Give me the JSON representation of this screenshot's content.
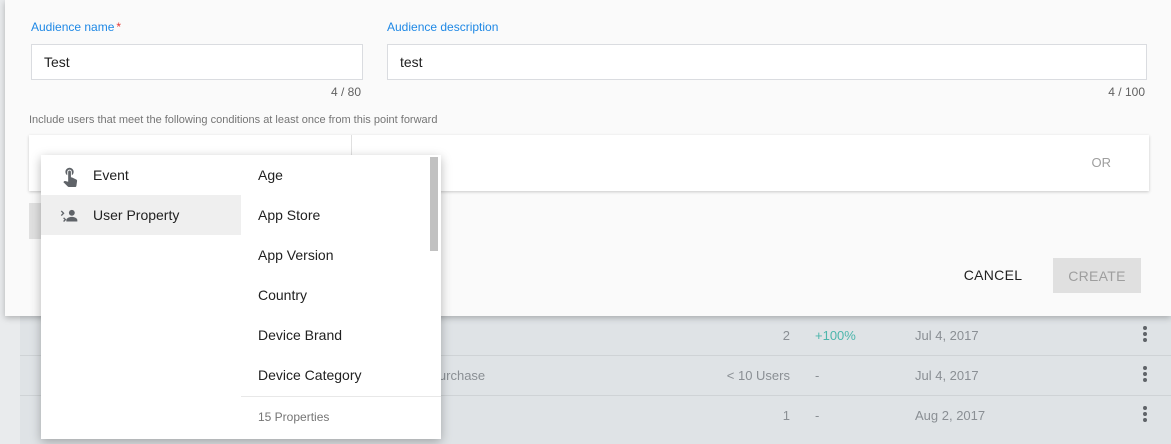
{
  "audience_name": {
    "label": "Audience name",
    "required_mark": "*",
    "value": "Test",
    "counter": "4 / 80"
  },
  "audience_description": {
    "label": "Audience description",
    "value": "test",
    "counter": "4 / 100"
  },
  "conditions": {
    "help_text": "Include users that meet the following conditions at least once from this point forward",
    "or_label": "OR"
  },
  "actions": {
    "cancel_label": "CANCEL",
    "create_label": "CREATE"
  },
  "menu": {
    "categories": [
      {
        "label": "Event",
        "icon": "touch-icon"
      },
      {
        "label": "User Property",
        "icon": "user-property-icon",
        "selected": true
      }
    ],
    "properties": [
      "Age",
      "App Store",
      "App Version",
      "Country",
      "Device Brand",
      "Device Category"
    ],
    "footer": "15 Properties"
  },
  "table": {
    "rows": [
      {
        "name": "",
        "users": "2",
        "change": "+100%",
        "date": "Jul 4, 2017"
      },
      {
        "name": "e a purchase",
        "users": "< 10 Users",
        "change": "-",
        "date": "Jul 4, 2017"
      },
      {
        "name": "",
        "users": "1",
        "change": "-",
        "date": "Aug 2, 2017"
      }
    ]
  },
  "colors": {
    "accent": "#1e88e5",
    "required": "#e53935",
    "positive": "#4db6ac"
  }
}
